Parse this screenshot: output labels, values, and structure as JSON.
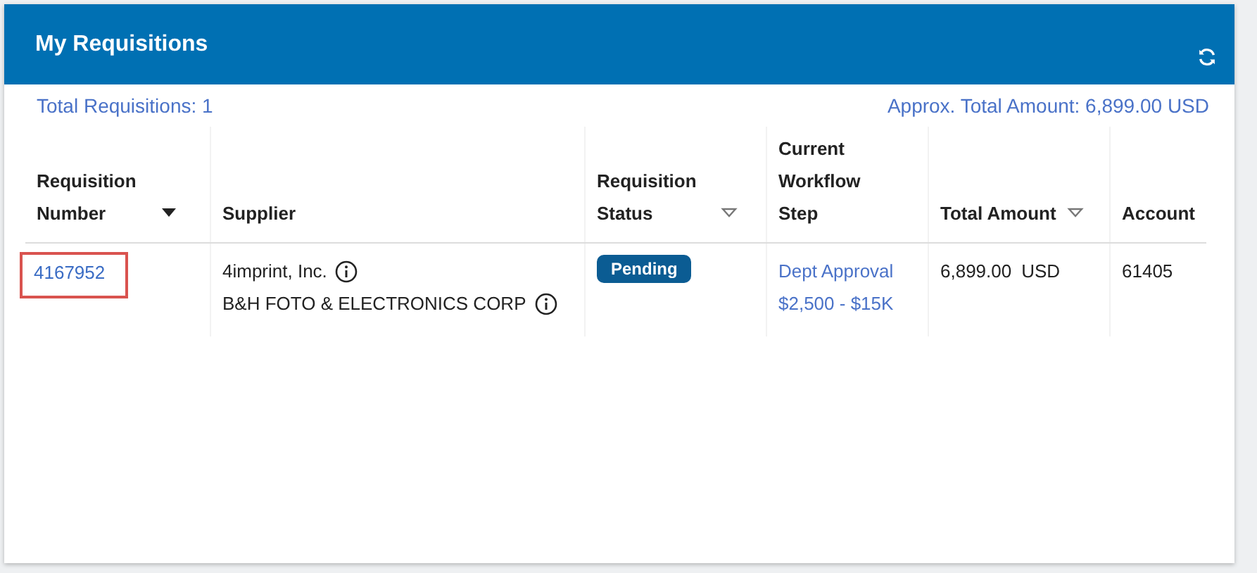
{
  "panel": {
    "title": "My Requisitions"
  },
  "summary": {
    "total_requisitions": "Total Requisitions: 1",
    "total_amount": "Approx. Total Amount: 6,899.00 USD"
  },
  "table": {
    "columns": [
      {
        "label": "Requisition Number",
        "sortable": true,
        "sorted": true
      },
      {
        "label": "Supplier",
        "sortable": false
      },
      {
        "label": "Requisition Status",
        "sortable": true,
        "sorted": false
      },
      {
        "label": "Current Workflow Step",
        "sortable": false
      },
      {
        "label": "Total Amount",
        "sortable": true,
        "sorted": false
      },
      {
        "label": "Account",
        "sortable": false
      }
    ],
    "rows": [
      {
        "number": "4167952",
        "highlighted": true,
        "suppliers": [
          "4imprint, Inc.",
          "B&H FOTO & ELECTRONICS CORP"
        ],
        "status": "Pending",
        "workflow_step": [
          "Dept Approval",
          "$2,500 - $15K"
        ],
        "amount": "6,899.00",
        "currency": "USD",
        "account": "61405"
      }
    ]
  }
}
